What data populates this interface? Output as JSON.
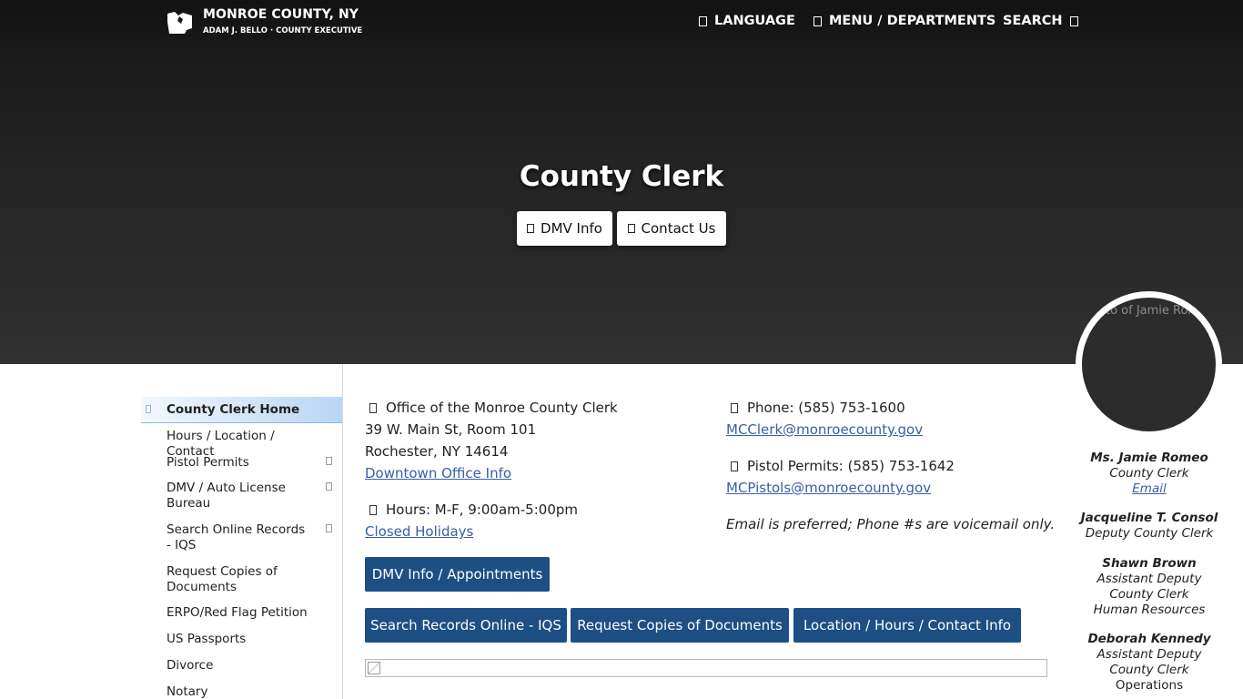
{
  "header": {
    "brand_title": "MONROE COUNTY, NY",
    "brand_subtitle": "ADAM J. BELLO · COUNTY EXECUTIVE",
    "nav": {
      "language": "LANGUAGE",
      "menu": "MENU / DEPARTMENTS",
      "search": "SEARCH"
    }
  },
  "hero": {
    "title": "County Clerk",
    "buttons": {
      "dmv": "DMV Info",
      "contact": "Contact Us"
    },
    "portrait_alt": "Photo of Jamie Romeo"
  },
  "sidebar": {
    "items": [
      {
        "label": "County Clerk Home"
      },
      {
        "label": "Hours / Location / Contact"
      },
      {
        "label": "Pistol Permits"
      },
      {
        "label": "DMV / Auto License Bureau"
      },
      {
        "label": "Search Online Records - IQS"
      },
      {
        "label": "Request Copies of Documents"
      },
      {
        "label": "ERPO/Red Flag Petition"
      },
      {
        "label": "US Passports"
      },
      {
        "label": "Divorce"
      },
      {
        "label": "Notary"
      }
    ]
  },
  "office": {
    "name": "Office of the Monroe County Clerk",
    "street": "39 W. Main St, Room 101",
    "city": "Rochester, NY 14614",
    "downtown_link": "Downtown Office Info",
    "hours": "Hours: M-F, 9:00am-5:00pm",
    "holidays_link": "Closed Holidays"
  },
  "contact": {
    "phone": "Phone: (585) 753-1600",
    "email": "MCClerk@monroecounty.gov",
    "pistol_phone": "Pistol Permits: (585) 753-1642",
    "pistol_email": "MCPistols@monroecounty.gov",
    "note": "Email is preferred; Phone #s are voicemail only."
  },
  "buttons": {
    "dmv_appointments": "DMV Info / Appointments",
    "search_records": "Search Records Online - IQS",
    "request_copies": "Request Copies of Documents",
    "location_hours": "Location / Hours / Contact Info"
  },
  "staff": [
    {
      "name": "Ms. Jamie Romeo",
      "title": "County Clerk",
      "link": "Email"
    },
    {
      "name": "Jacqueline T. Consol",
      "title": "Deputy County Clerk"
    },
    {
      "name": "Shawn Brown",
      "title1": "Assistant Deputy",
      "title2": "County Clerk",
      "dept": "Human Resources"
    },
    {
      "name": "Deborah Kennedy",
      "title1": "Assistant Deputy",
      "title2": "County Clerk",
      "dept": "Operations"
    }
  ]
}
